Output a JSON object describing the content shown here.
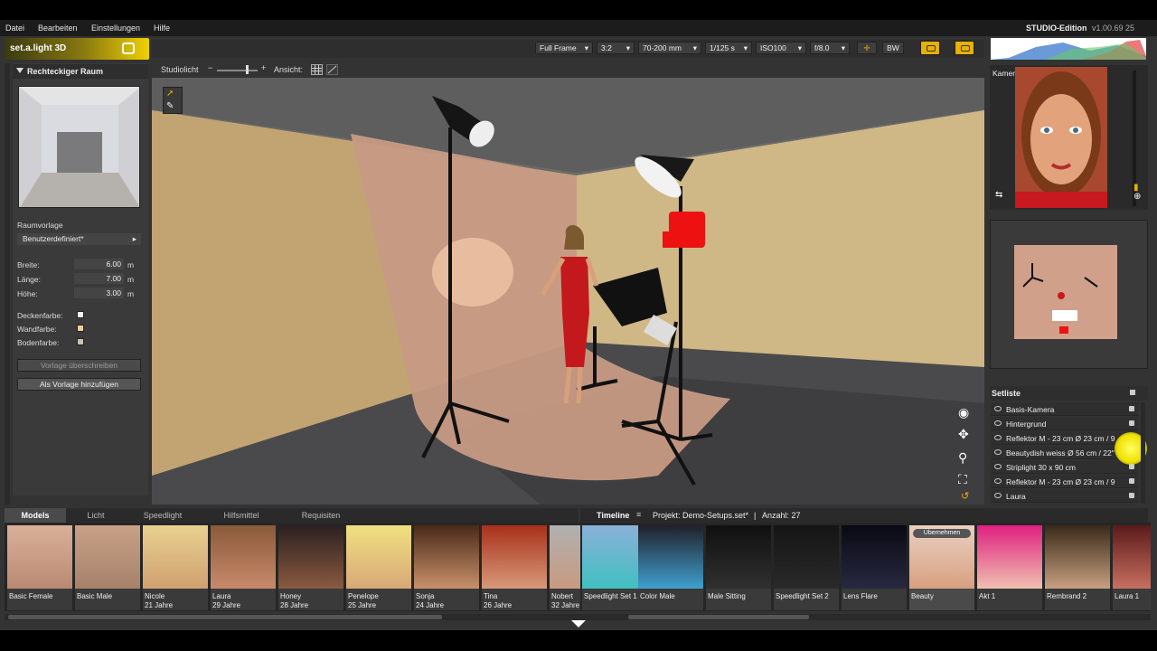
{
  "menu": {
    "items": [
      "Datei",
      "Bearbeiten",
      "Einstellungen",
      "Hilfe"
    ],
    "edition": "STUDIO-Edition",
    "version": "v1.00.69  25"
  },
  "logo": {
    "text": "set.a.light 3D"
  },
  "left": {
    "panel_title": "Rechteckiger Raum",
    "room_template_label": "Raumvorlage",
    "room_template_value": "Benutzerdefiniert*",
    "width_label": "Breite:",
    "width_value": "6.00",
    "length_label": "Länge:",
    "length_value": "7.00",
    "height_label": "Höhe:",
    "height_value": "3.00",
    "unit": "m",
    "ceiling_label": "Deckenfarbe:",
    "wall_label": "Wandfarbe:",
    "floor_label": "Bodenfarbe:",
    "ceiling_color": "#f2f2f2",
    "wall_color": "#e8d0a0",
    "floor_color": "#cfc0b0",
    "overwrite_button": "Vorlage überschreiben",
    "add_button": "Als Vorlage hinzufügen"
  },
  "toolbar": {
    "sensor": "Full Frame",
    "ratio": "3:2",
    "lens": "70-200 mm",
    "shutter": "1/125 s",
    "iso": "ISO100",
    "aperture": "f/8.0",
    "bw": "BW"
  },
  "subbar": {
    "studio_light": "Studiolicht",
    "view": "Ansicht:"
  },
  "right": {
    "camera_label": "Kamera",
    "setliste_title": "Setliste",
    "set_items": [
      "Basis-Kamera",
      "Hintergrund",
      "Reflektor M - 23 cm Ø 23 cm / 9",
      "Beautydish weiss Ø 56 cm / 22\"",
      "Striplight 30 x 90 cm",
      "Reflektor M - 23 cm Ø 23 cm / 9",
      "Laura"
    ]
  },
  "bottom": {
    "tabs": [
      "Models",
      "Licht",
      "Speedlight",
      "Hilfsmittel",
      "Requisiten"
    ],
    "timeline": "Timeline",
    "project": "Projekt: Demo-Setups.set*",
    "count": "Anzahl: 27",
    "models": [
      {
        "name": "Basic Female",
        "sub": ""
      },
      {
        "name": "Basic Male",
        "sub": ""
      },
      {
        "name": "Nicole",
        "sub": "21 Jahre"
      },
      {
        "name": "Laura",
        "sub": "29 Jahre"
      },
      {
        "name": "Honey",
        "sub": "28 Jahre"
      },
      {
        "name": "Penelope",
        "sub": "25 Jahre"
      },
      {
        "name": "Sonja",
        "sub": "24 Jahre"
      },
      {
        "name": "Tina",
        "sub": "26 Jahre"
      },
      {
        "name": "Nobert",
        "sub": "32 Jahre"
      }
    ],
    "setups": [
      {
        "name": "Speedlight Set 1"
      },
      {
        "name": "Color Male"
      },
      {
        "name": "Male Sitting"
      },
      {
        "name": "Speedlight Set 2"
      },
      {
        "name": "Lens Flare"
      },
      {
        "name": "Beauty"
      },
      {
        "name": "Akt 1"
      },
      {
        "name": "Rembrand 2"
      },
      {
        "name": "Laura 1"
      }
    ],
    "apply_label": "Übernehmen"
  }
}
